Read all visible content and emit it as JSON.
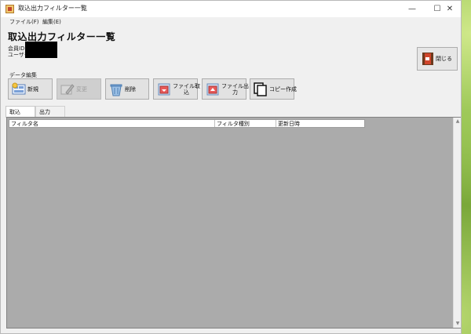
{
  "window": {
    "title": "取込出力フィルター一覧",
    "controls": {
      "minimize": "—",
      "maximize": "☐",
      "close": "✕"
    }
  },
  "menu": {
    "items": [
      {
        "label": "ファイル(F)"
      },
      {
        "label": "編集(E)"
      }
    ]
  },
  "page_title": "取込出力フィルター一覧",
  "info": {
    "member_id_label": "会員ID",
    "user_label": "ユーザー"
  },
  "close_button": {
    "label": "閉じる"
  },
  "toolbar": {
    "group_label": "データ編集",
    "buttons": [
      {
        "label": "新規",
        "disabled": false
      },
      {
        "label": "変更",
        "disabled": true
      },
      {
        "label": "削除",
        "disabled": false
      },
      {
        "label_line1": "ファイル取",
        "label_line2": "込",
        "disabled": false
      },
      {
        "label_line1": "ファイル出",
        "label_line2": "力",
        "disabled": false
      },
      {
        "label": "コピー作成",
        "disabled": false
      }
    ]
  },
  "tabs": [
    {
      "label": "取込",
      "active": true
    },
    {
      "label": "出力",
      "active": false
    }
  ],
  "grid": {
    "columns": [
      {
        "label": "フィルタ名"
      },
      {
        "label": "フィルタ種別"
      },
      {
        "label": "更新日時"
      }
    ],
    "rows": []
  },
  "colors": {
    "grid_bg": "#ababab",
    "window_bg": "#f0f0f0",
    "accent_red": "#d1452b"
  }
}
